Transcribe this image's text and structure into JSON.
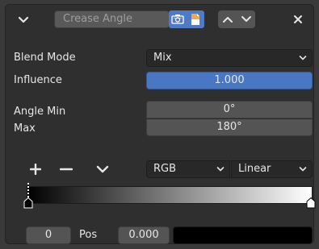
{
  "header": {
    "modifier_name": "Crease Angle",
    "colors": {
      "toggle_active": "#4d7bc5",
      "viewport_icon": "#f0a94a"
    }
  },
  "blend_mode": {
    "label": "Blend Mode",
    "value": "Mix"
  },
  "influence": {
    "label": "Influence",
    "value": "1.000",
    "fraction": 1.0
  },
  "angle_min": {
    "label": "Angle Min",
    "value": "0°"
  },
  "angle_max": {
    "label": "Max",
    "value": "180°"
  },
  "ramp_toolbar": {
    "color_mode": "RGB",
    "interpolation": "Linear"
  },
  "color_ramp": {
    "stops": [
      {
        "position": 0.0,
        "color": "#000000",
        "active": true
      },
      {
        "position": 1.0,
        "color": "#ffffff",
        "active": false
      }
    ]
  },
  "stop_editor": {
    "index": "0",
    "pos_label": "Pos",
    "pos_value": "0.000",
    "color": "#000000"
  }
}
